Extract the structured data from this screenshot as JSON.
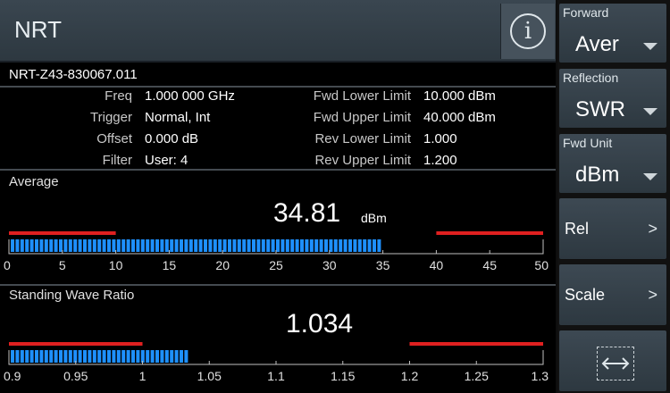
{
  "header": {
    "title": "NRT",
    "info_icon": "info-icon"
  },
  "device_id": "NRT-Z43-830067.011",
  "params_left": [
    {
      "label": "Freq",
      "value": "1.000 000 GHz"
    },
    {
      "label": "Trigger",
      "value": "Normal, Int"
    },
    {
      "label": "Offset",
      "value": "0.000 dB"
    },
    {
      "label": "Filter",
      "value": "User: 4"
    }
  ],
  "params_right": [
    {
      "label": "Fwd Lower Limit",
      "value": "10.000 dBm"
    },
    {
      "label": "Fwd Upper Limit",
      "value": "40.000 dBm"
    },
    {
      "label": "Rev Lower Limit",
      "value": "1.000"
    },
    {
      "label": "Rev Upper Limit",
      "value": "1.200"
    }
  ],
  "average": {
    "title": "Average",
    "value": "34.81",
    "unit": "dBm",
    "scale": [
      "0",
      "5",
      "10",
      "15",
      "20",
      "25",
      "30",
      "35",
      "40",
      "45",
      "50"
    ],
    "min": 0,
    "max": 50,
    "reading": 34.81,
    "lower_limit": 10,
    "upper_limit": 40
  },
  "swr": {
    "title": "Standing Wave Ratio",
    "value": "1.034",
    "scale": [
      "0.9",
      "0.95",
      "1",
      "1.05",
      "1.1",
      "1.15",
      "1.2",
      "1.25",
      "1.3"
    ],
    "min": 0.9,
    "max": 1.3,
    "reading": 1.034,
    "lower_limit": 1.0,
    "upper_limit": 1.2
  },
  "sidebar": {
    "forward": {
      "caption": "Forward",
      "value": "Aver"
    },
    "reflection": {
      "caption": "Reflection",
      "value": "SWR"
    },
    "fwd_unit": {
      "caption": "Fwd Unit",
      "value": "dBm"
    },
    "rel_label": "Rel",
    "scale_label": "Scale",
    "chevron": ">"
  },
  "colors": {
    "bar_fill": "#1e90ff",
    "limit_line": "#e02020",
    "background": "#000000"
  }
}
